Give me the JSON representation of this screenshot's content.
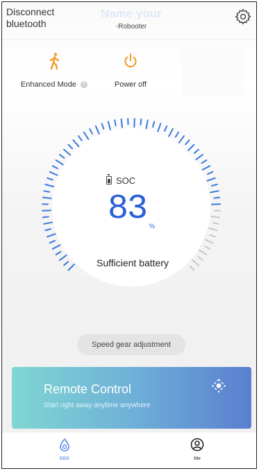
{
  "header": {
    "disconnect_label": "Disconnect bluetooth",
    "name_title": "Name your",
    "name_subtitle": "-Robooter",
    "settings_icon": "gear-icon"
  },
  "modes": [
    {
      "label": "Enhanced Mode",
      "icon": "walking-person-icon",
      "color": "#f29a1f"
    },
    {
      "label": "Power off",
      "icon": "power-icon",
      "color": "#f29a1f"
    }
  ],
  "gauge": {
    "soc_label": "SOC",
    "value": "83",
    "unit": "%",
    "level_percent": 83,
    "status": "Sufficient battery",
    "active_color": "#3a78e0",
    "inactive_color": "#c8c8c8"
  },
  "speed_button": "Speed gear adjustment",
  "remote": {
    "title": "Remote Control",
    "subtitle": "Start right away anytime anywhere",
    "icon": "target-icon"
  },
  "nav": [
    {
      "label": "BBR",
      "icon": "drop-icon",
      "active": true,
      "color": "#5a8ae6"
    },
    {
      "label": "Me",
      "icon": "user-icon",
      "active": false,
      "color": "#222222"
    }
  ]
}
